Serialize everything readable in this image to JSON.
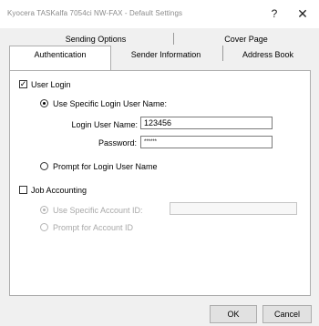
{
  "window": {
    "title": "Kyocera TASKalfa 7054ci NW-FAX - Default Settings",
    "help_glyph": "?",
    "close_glyph": "✕"
  },
  "tabs": {
    "row_back": [
      "Sending Options",
      "Cover Page"
    ],
    "row_front": [
      "Authentication",
      "Sender Information",
      "Address Book"
    ],
    "active": "Authentication"
  },
  "auth": {
    "user_login": {
      "label": "User Login",
      "checked": true
    },
    "use_specific": {
      "label": "Use Specific Login User Name:",
      "selected": true
    },
    "login_user_name": {
      "label": "Login User Name:",
      "value": "123456"
    },
    "password": {
      "label": "Password:",
      "value": "******"
    },
    "prompt_login": {
      "label": "Prompt for Login User Name",
      "selected": false
    }
  },
  "job_accounting": {
    "label": "Job Accounting",
    "checked": false,
    "use_specific_account": {
      "label": "Use Specific Account ID:",
      "value": "",
      "disabled": true,
      "selected": true
    },
    "prompt_account": {
      "label": "Prompt for Account ID",
      "disabled": true
    }
  },
  "buttons": {
    "ok": "OK",
    "cancel": "Cancel"
  }
}
